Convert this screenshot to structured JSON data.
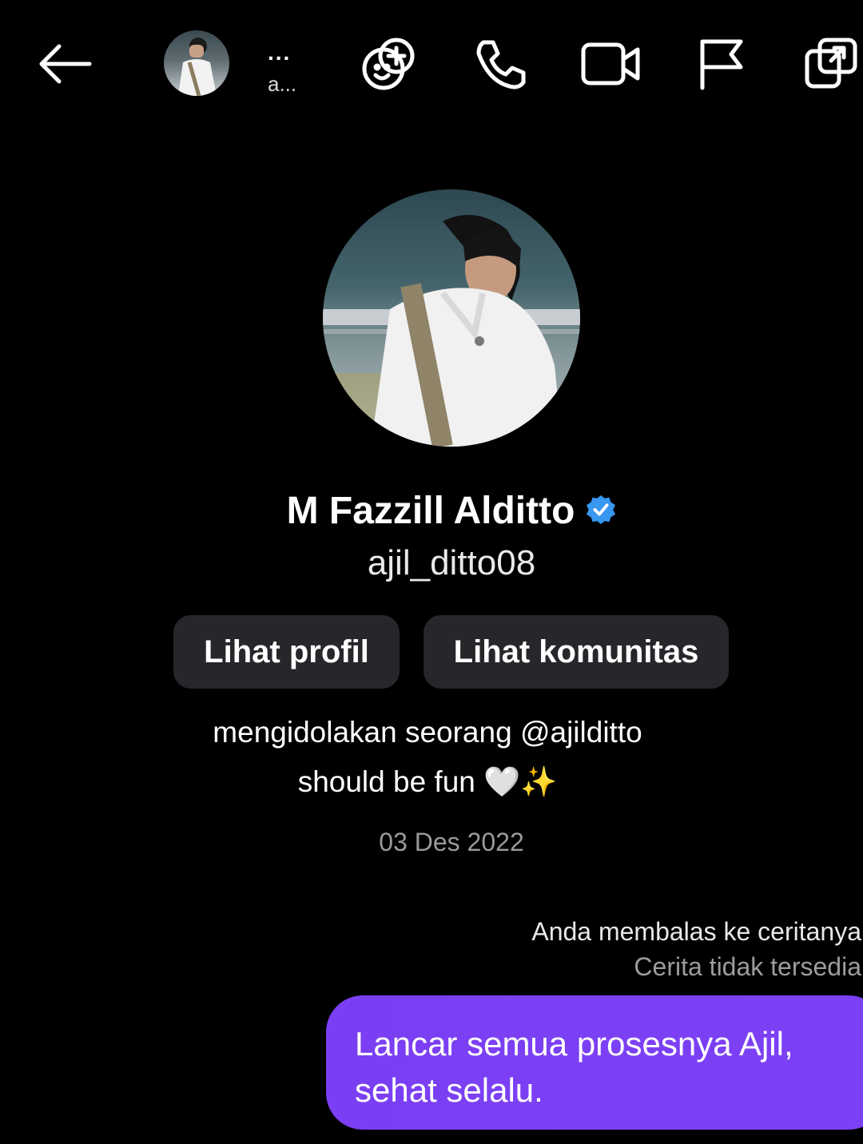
{
  "header": {
    "name_truncated": "...",
    "subtitle_truncated": "a...",
    "icons": [
      "back-arrow-icon",
      "avatar",
      "add-effect-icon",
      "phone-icon",
      "video-camera-icon",
      "flag-icon",
      "picture-in-picture-icon"
    ]
  },
  "profile": {
    "name": "M Fazzill Alditto",
    "handle": "ajil_ditto08",
    "verified_color": "#3897f0",
    "buttons": {
      "view_profile": "Lihat profil",
      "view_community": "Lihat komunitas"
    },
    "bio_line1": "mengidolakan seorang @ajilditto",
    "bio_line2": "should be fun 🤍✨",
    "date": "03 Des 2022"
  },
  "conversation": {
    "reply_note": "Anda membalas ke ceritanya",
    "reply_unavailable": "Cerita tidak tersedia",
    "message_line1": "Lancar semua prosesnya Ajil,",
    "message_line2": "sehat selalu.",
    "bubble_color": "#7b3ff3"
  }
}
